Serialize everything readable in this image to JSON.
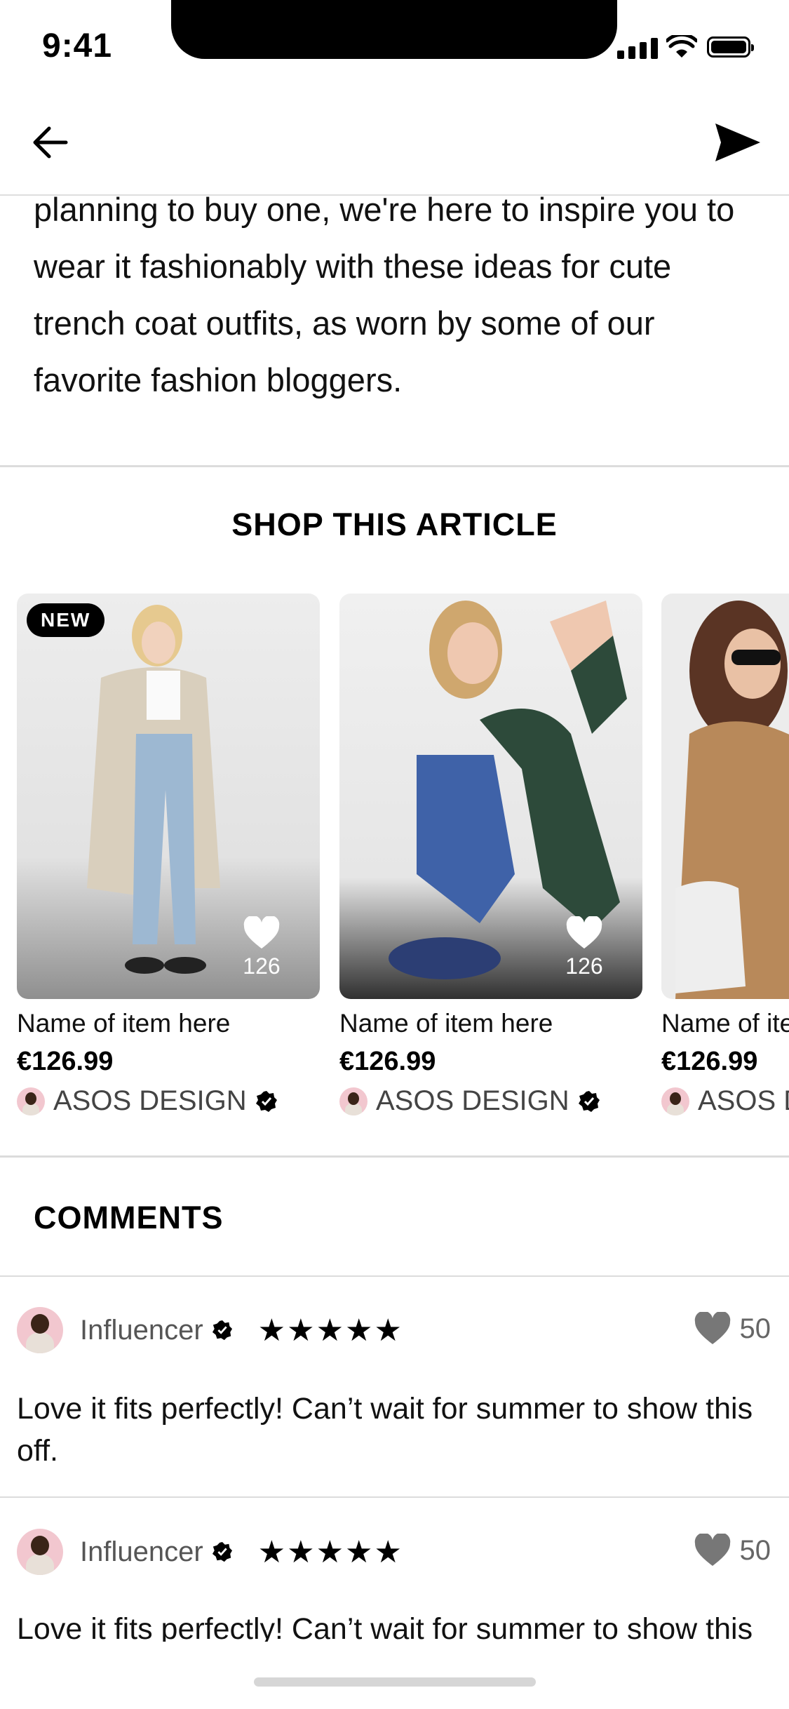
{
  "status_bar": {
    "time": "9:41"
  },
  "article": {
    "text": "planning to buy one, we're here to inspire you to wear it fashionably with these ideas for cute trench coat outfits, as worn by some of our favorite fashion bloggers."
  },
  "shop": {
    "title": "SHOP THIS ARTICLE",
    "products": [
      {
        "badge": "NEW",
        "likes": "126",
        "name": "Name of item here",
        "price": "€126.99",
        "brand": "ASOS DESIGN"
      },
      {
        "likes": "126",
        "name": "Name of item here",
        "price": "€126.99",
        "brand": "ASOS DESIGN"
      },
      {
        "name": "Name of item here",
        "price": "€126.99",
        "brand": "ASOS DESIGN"
      }
    ]
  },
  "comments": {
    "title": "COMMENTS",
    "items": [
      {
        "name": "Influencer",
        "stars": "★★★★★",
        "likes": "50",
        "text": "Love it fits perfectly! Can’t wait for summer to show this off."
      },
      {
        "name": "Influencer",
        "stars": "★★★★★",
        "likes": "50",
        "text": "Love it fits perfectly! Can’t wait for summer to show this off."
      }
    ]
  },
  "colors": {
    "accent": "#000000",
    "avatar_bg": "#f2c7cf",
    "divider": "#dcdcdc"
  }
}
